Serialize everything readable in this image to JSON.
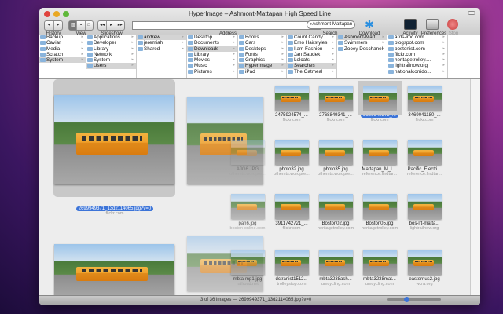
{
  "window": {
    "title": "HyperImage – Ashmont-Mattapan High Speed Line"
  },
  "toolbar": {
    "history": "History",
    "view": "View",
    "slideshow": "Slideshow",
    "address": "Address",
    "search": "Search",
    "search_value": "Ashmont-Mattapan",
    "download": "Download",
    "activity": "Activity",
    "preferences": "Preferences",
    "stop": "Stop",
    "address_value": ""
  },
  "columns": [
    [
      "Backup",
      "Caviar",
      "Media",
      "Scratch",
      "System"
    ],
    [
      "Applications",
      "Developer",
      "Library",
      "Network",
      "System",
      "Users"
    ],
    [
      "andrew",
      "jeremiah",
      "Shared"
    ],
    [
      "Desktop",
      "Documents",
      "Downloads",
      "Library",
      "Movies",
      "Music",
      "Pictures"
    ],
    [
      "Books",
      "Cars",
      "Desktops",
      "Fonts",
      "Graphics",
      "HyperImage",
      "iPad"
    ],
    [
      "Count Candy",
      "Emo Hairstyles",
      "I am Fashion",
      "Jan Saudek",
      "Lolcats",
      "Searches",
      "The Oatmeal"
    ],
    [
      "Ashmont-Matt...",
      "Swimmers",
      "Zooey Deschanel"
    ],
    [
      "ards-imc.com",
      "blogspot.com",
      "bostonist.com",
      "flickr.com",
      "heritagetrolley....",
      "lightrailnow.org",
      "nationalcorrido..."
    ]
  ],
  "selected": [
    4,
    5,
    0,
    2,
    5,
    5,
    0,
    -1
  ],
  "featured": {
    "name": "2699949371_13d2114065.jpg?v=0",
    "source": "flickr.com"
  },
  "images": [
    {
      "name": "2475924574_...",
      "source": "flickr.com"
    },
    {
      "name": "2768849341_...",
      "source": "flickr.com"
    },
    {
      "name": "2699949371_...",
      "source": "flickr.com",
      "selected": true
    },
    {
      "name": "3469041180_...",
      "source": "flickr.com"
    },
    {
      "name": "AJG6.JPG",
      "source": "othemts.wordpre..."
    },
    {
      "name": "photo32.jpg",
      "source": "othemts.wordpre..."
    },
    {
      "name": "photo35.jpg",
      "source": "othemts.wordpre..."
    },
    {
      "name": "Mattapan_M_L...",
      "source": "reference.findtar..."
    },
    {
      "name": "Pacific_Electri...",
      "source": "reference.findtar..."
    },
    {
      "name": "pan6.jpg",
      "source": "boston-online.com"
    },
    {
      "name": "3911742721_...",
      "source": "flickr.com"
    },
    {
      "name": "Boston02.jpg",
      "source": "heritagetrolley.com"
    },
    {
      "name": "Boston05.jpg",
      "source": "heritagetrolley.com"
    },
    {
      "name": "bos-lrt-matta...",
      "source": "lightrailnow.org"
    },
    {
      "name": "mbta-mp1.jpg",
      "source": "railroad.net"
    },
    {
      "name": "dctranist1512...",
      "source": "trolleystop.com"
    },
    {
      "name": "mbta3238ash...",
      "source": "umcycling.com"
    },
    {
      "name": "mbta3238mat...",
      "source": "umcycling.com"
    },
    {
      "name": "easternus2.jpg",
      "source": "wcra.org"
    }
  ],
  "status": "3 of 36 images — 2699949371_13d2114065.jpg?v=0",
  "zoom_level": 0.35
}
